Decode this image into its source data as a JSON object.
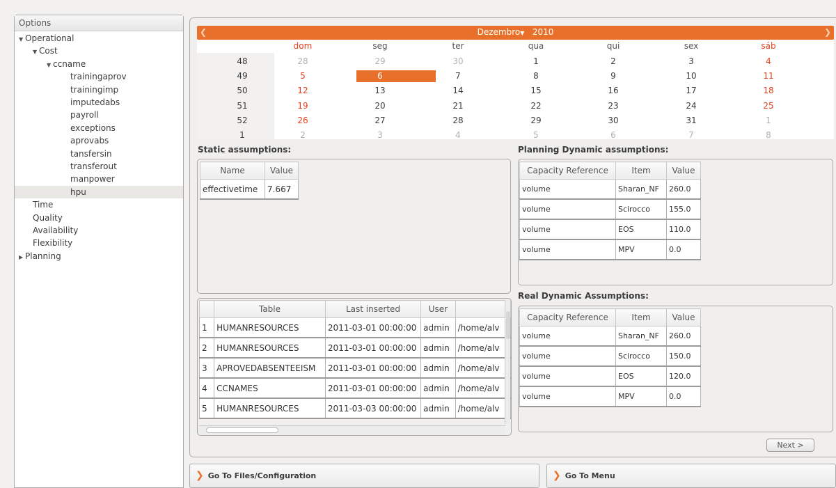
{
  "options_panel": {
    "header": "Options",
    "tree": [
      {
        "label": "Operational",
        "level": 0,
        "expanded": true
      },
      {
        "label": "Cost",
        "level": 1,
        "expanded": true
      },
      {
        "label": "ccname",
        "level": 2,
        "expanded": true
      },
      {
        "label": "trainingaprov",
        "level": 3
      },
      {
        "label": "trainingimp",
        "level": 3
      },
      {
        "label": "imputedabs",
        "level": 3
      },
      {
        "label": "payroll",
        "level": 3
      },
      {
        "label": "exceptions",
        "level": 3
      },
      {
        "label": "aprovabs",
        "level": 3
      },
      {
        "label": "tansfersin",
        "level": 3
      },
      {
        "label": "transferout",
        "level": 3
      },
      {
        "label": "manpower",
        "level": 3
      },
      {
        "label": "hpu",
        "level": 3,
        "selected": true
      },
      {
        "label": "Time",
        "level": 1
      },
      {
        "label": "Quality",
        "level": 1
      },
      {
        "label": "Availability",
        "level": 1
      },
      {
        "label": "Flexibility",
        "level": 1
      },
      {
        "label": "Planning",
        "level": 0,
        "expanded": false
      }
    ]
  },
  "calendar": {
    "month": "Dezembro",
    "year": "2010",
    "prev_icon": "chevron-left-icon",
    "next_icon": "chevron-right-icon",
    "weekdays": [
      "dom",
      "seg",
      "ter",
      "qua",
      "qui",
      "sex",
      "sáb"
    ],
    "weeks": [
      {
        "week": "48",
        "days": [
          "28",
          "29",
          "30",
          "1",
          "2",
          "3",
          "4"
        ]
      },
      {
        "week": "49",
        "days": [
          "5",
          "6",
          "7",
          "8",
          "9",
          "10",
          "11"
        ]
      },
      {
        "week": "50",
        "days": [
          "12",
          "13",
          "14",
          "15",
          "16",
          "17",
          "18"
        ]
      },
      {
        "week": "51",
        "days": [
          "19",
          "20",
          "21",
          "22",
          "23",
          "24",
          "25"
        ]
      },
      {
        "week": "52",
        "days": [
          "26",
          "27",
          "28",
          "29",
          "30",
          "31",
          "1"
        ]
      },
      {
        "week": "1",
        "days": [
          "2",
          "3",
          "4",
          "5",
          "6",
          "7",
          "8"
        ]
      }
    ],
    "selected_day": "6",
    "accent": "#e8702a",
    "weekend_color": "#e53e1a"
  },
  "static_assumptions": {
    "title": "Static assumptions:",
    "columns": [
      "Name",
      "Value"
    ],
    "rows": [
      [
        "effectivetime",
        "7.667"
      ]
    ]
  },
  "planning_dynamic": {
    "title": "Planning Dynamic assumptions:",
    "columns": [
      "Capacity Reference",
      "Item",
      "Value"
    ],
    "rows": [
      [
        "volume",
        "Sharan_NF",
        "260.0"
      ],
      [
        "volume",
        "Scirocco",
        "155.0"
      ],
      [
        "volume",
        "EOS",
        "110.0"
      ],
      [
        "volume",
        "MPV",
        "0.0"
      ]
    ]
  },
  "real_dynamic": {
    "title": "Real Dynamic Assumptions:",
    "columns": [
      "Capacity Reference",
      "Item",
      "Value"
    ],
    "rows": [
      [
        "volume",
        "Sharan_NF",
        "260.0"
      ],
      [
        "volume",
        "Scirocco",
        "150.0"
      ],
      [
        "volume",
        "EOS",
        "120.0"
      ],
      [
        "volume",
        "MPV",
        "0.0"
      ]
    ]
  },
  "files_table": {
    "columns": [
      "",
      "Table",
      "Last inserted",
      "User",
      ""
    ],
    "rows": [
      [
        "1",
        "HUMANRESOURCES",
        "2011-03-01 00:00:00",
        "admin",
        "/home/alv"
      ],
      [
        "2",
        "HUMANRESOURCES",
        "2011-03-01 00:00:00",
        "admin",
        "/home/alv"
      ],
      [
        "3",
        "APROVEDABSENTEEISM",
        "2011-03-01 00:00:00",
        "admin",
        "/home/alv"
      ],
      [
        "4",
        "CCNAMES",
        "2011-03-01 00:00:00",
        "admin",
        "/home/alv"
      ],
      [
        "5",
        "HUMANRESOURCES",
        "2011-03-03 00:00:00",
        "admin",
        "/home/alv"
      ]
    ]
  },
  "buttons": {
    "next": "Next >",
    "go_files": "Go To Files/Configuration",
    "go_menu": "Go To Menu"
  }
}
